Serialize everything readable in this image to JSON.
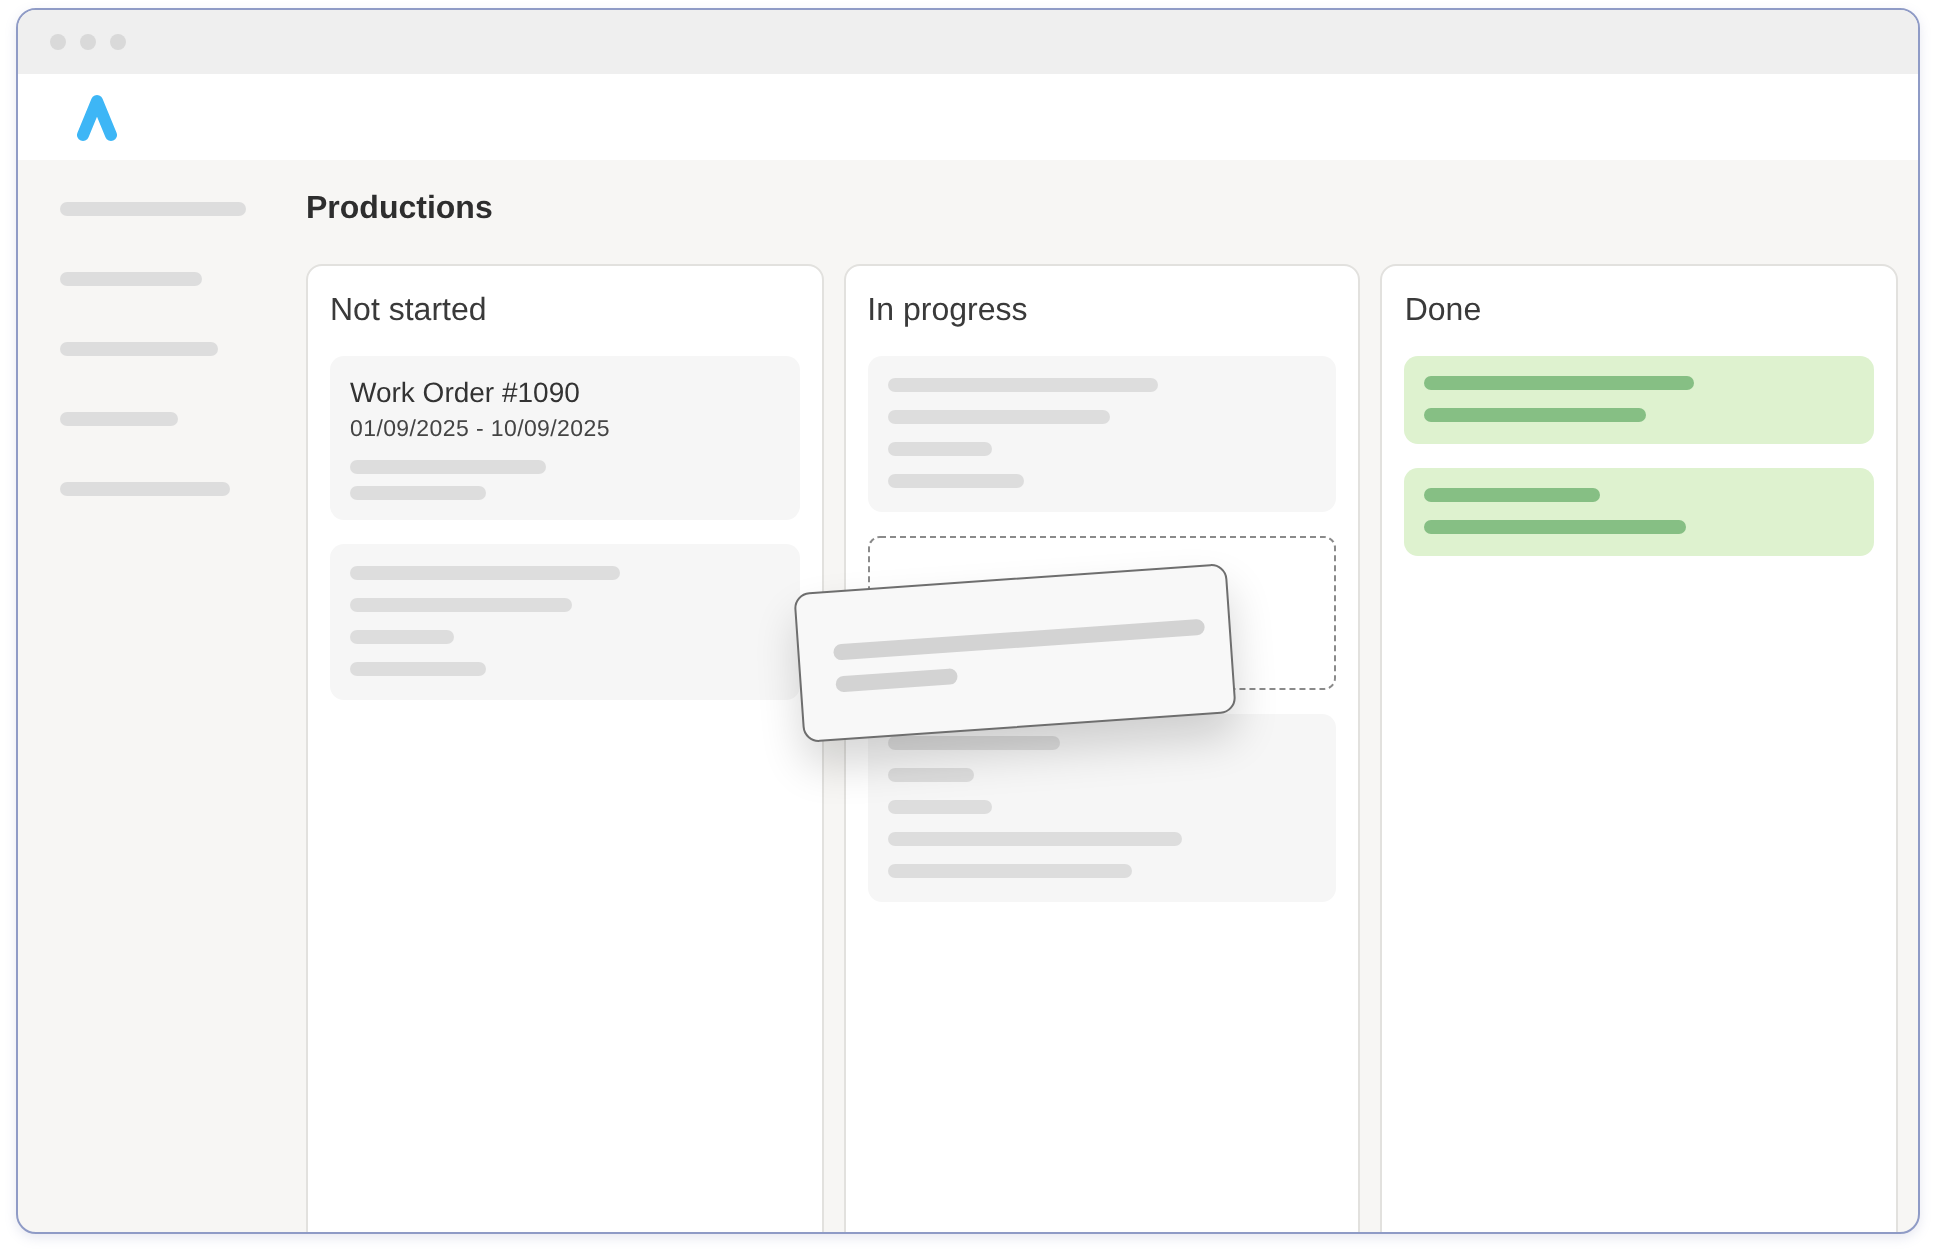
{
  "page": {
    "title": "Productions"
  },
  "columns": [
    {
      "title": "Not started",
      "cards": [
        {
          "kind": "work-order",
          "title": "Work Order #1090",
          "dates": "01/09/2025 - 10/09/2025"
        },
        {
          "kind": "skeleton"
        }
      ]
    },
    {
      "title": "In progress",
      "cards": [
        {
          "kind": "skeleton"
        },
        {
          "kind": "drop-target",
          "dragging": true
        },
        {
          "kind": "skeleton"
        }
      ]
    },
    {
      "title": "Done",
      "cards": [
        {
          "kind": "completed"
        },
        {
          "kind": "completed"
        }
      ]
    }
  ]
}
